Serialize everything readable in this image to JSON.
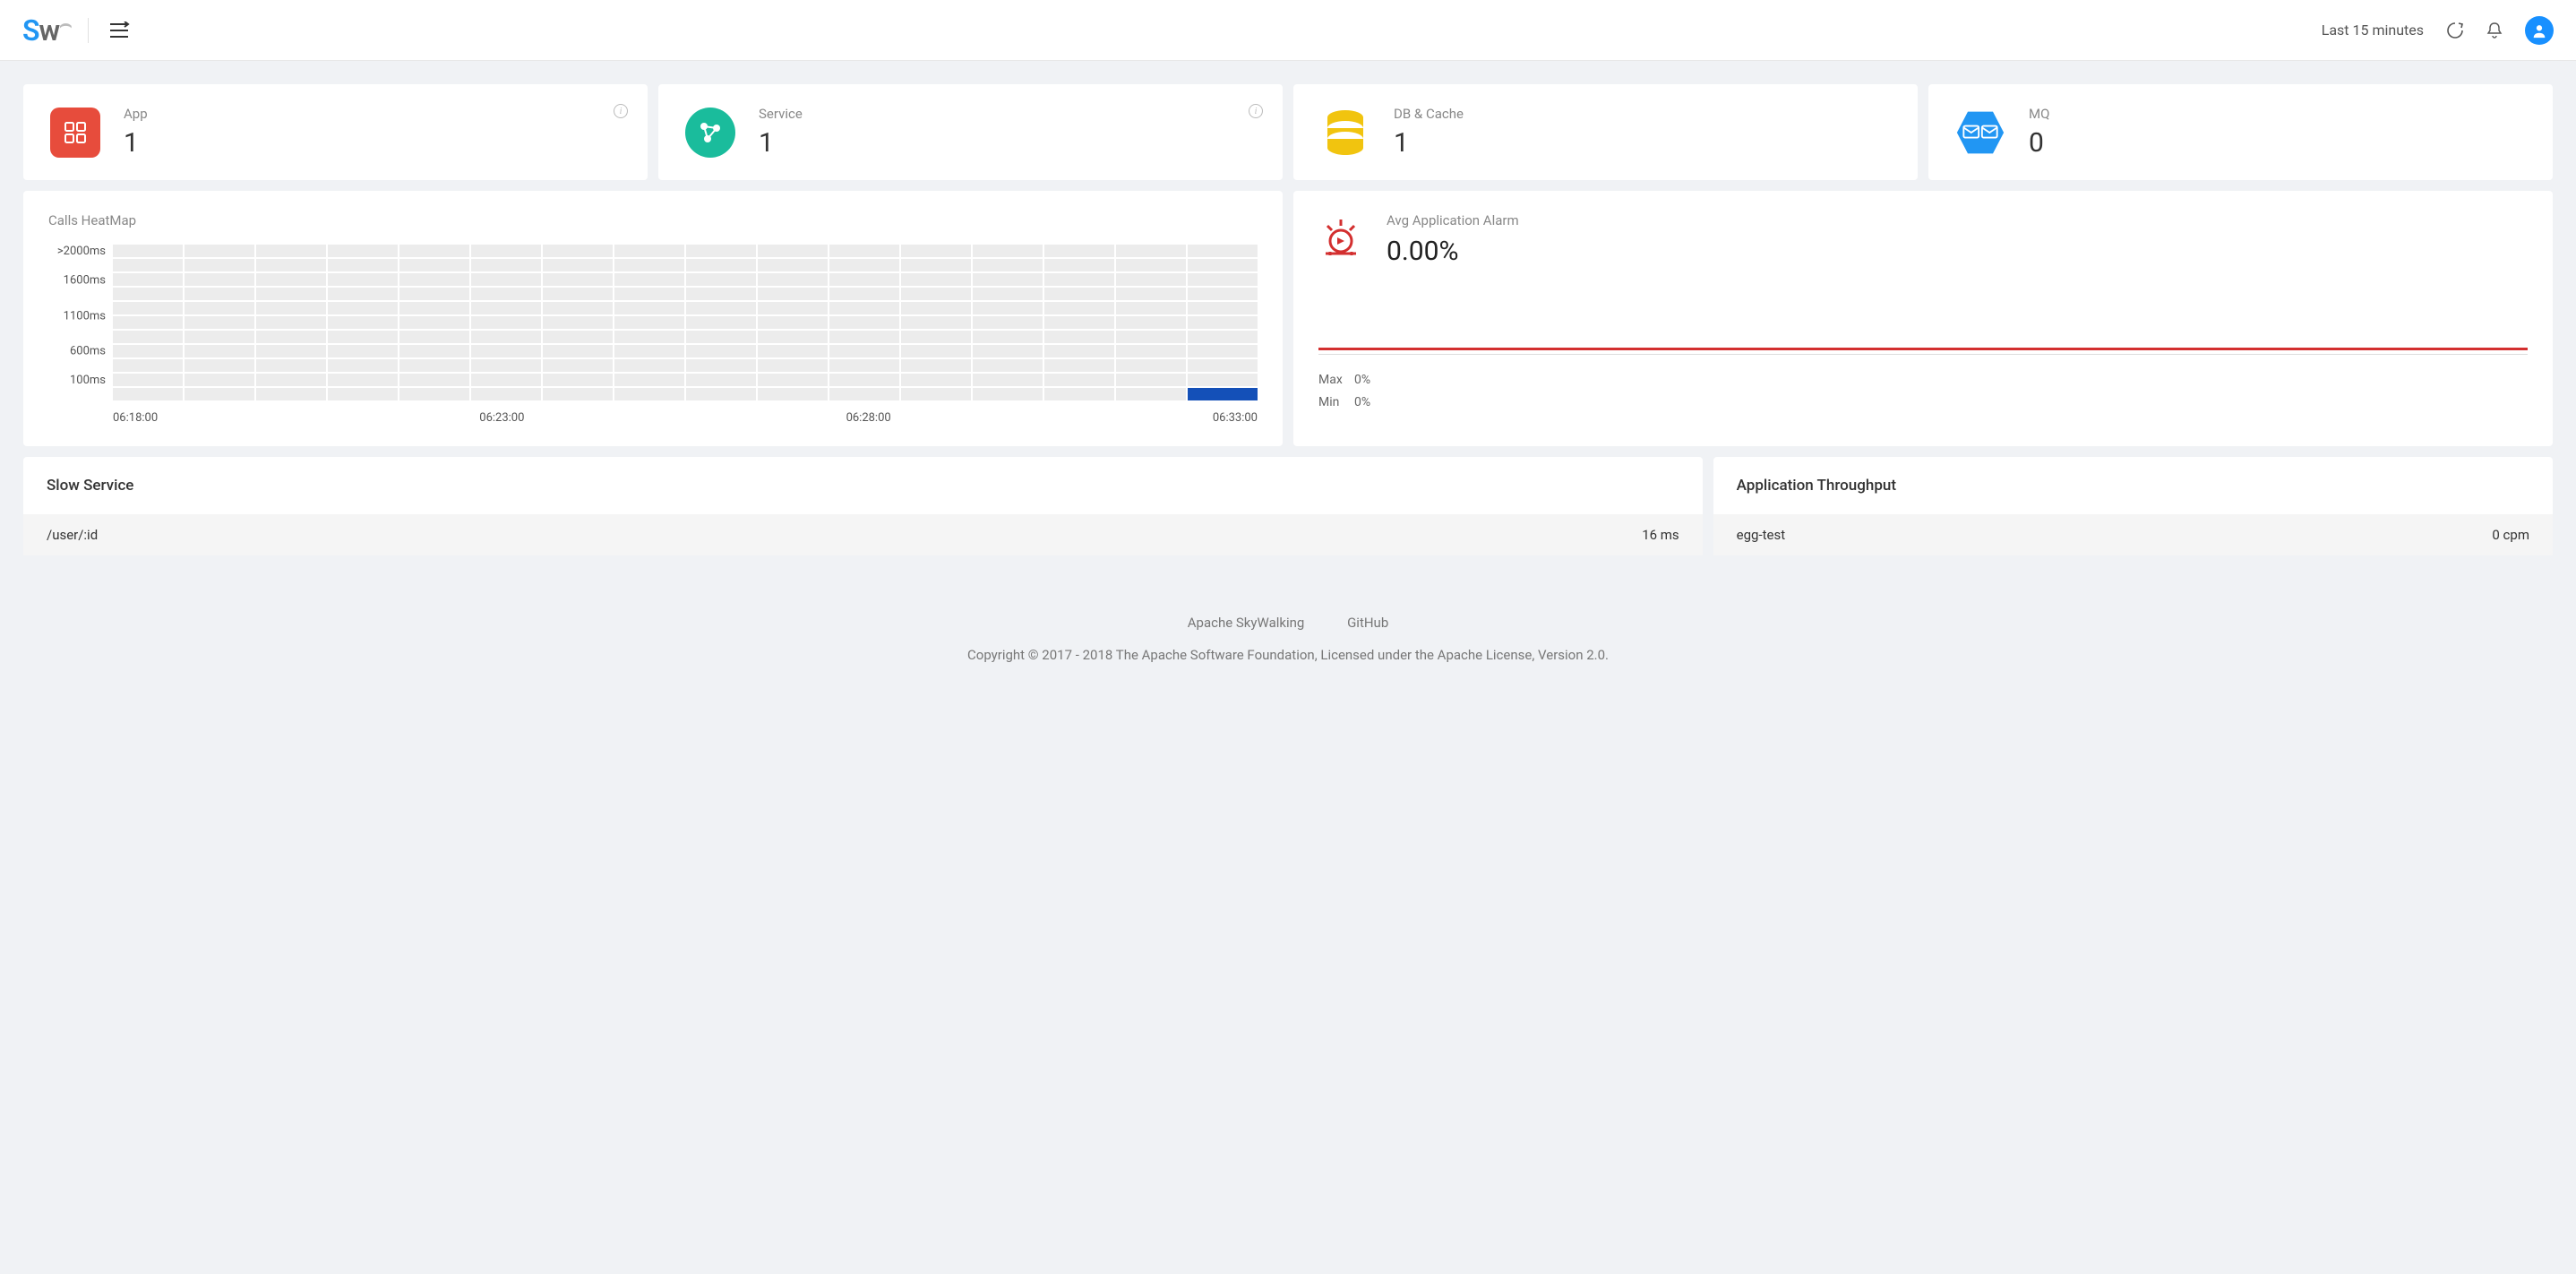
{
  "header": {
    "time_range": "Last 15 minutes"
  },
  "cards": [
    {
      "label": "App",
      "value": "1",
      "icon_bg": "#e74c3c",
      "info": true
    },
    {
      "label": "Service",
      "value": "1",
      "icon_bg": "#1abc9c",
      "info": true
    },
    {
      "label": "DB & Cache",
      "value": "1",
      "icon_bg": "#f1c40f",
      "info": false
    },
    {
      "label": "MQ",
      "value": "0",
      "icon_bg": "#2196f3",
      "info": false
    }
  ],
  "heatmap": {
    "title": "Calls HeatMap",
    "ylabels": [
      ">2000ms",
      "1600ms",
      "1100ms",
      "600ms",
      "100ms"
    ],
    "xlabels": [
      "06:18:00",
      "06:23:00",
      "06:28:00",
      "06:33:00"
    ]
  },
  "alarm": {
    "title": "Avg Application Alarm",
    "value": "0.00%",
    "max_label": "Max",
    "max_value": "0%",
    "min_label": "Min",
    "min_value": "0%"
  },
  "slow_service": {
    "title": "Slow Service",
    "rows": [
      {
        "name": "/user/:id",
        "value": "16 ms"
      }
    ]
  },
  "throughput": {
    "title": "Application Throughput",
    "rows": [
      {
        "name": "egg-test",
        "value": "0 cpm"
      }
    ]
  },
  "footer": {
    "link1": "Apache SkyWalking",
    "link2": "GitHub",
    "copyright": "Copyright © 2017 - 2018 The Apache Software Foundation, Licensed under the Apache License, Version 2.0."
  },
  "chart_data": {
    "type": "heatmap",
    "title": "Calls HeatMap",
    "x_range": [
      "06:18:00",
      "06:33:00"
    ],
    "x_step_minutes": 1,
    "y_bins": [
      "100ms",
      "600ms",
      "1100ms",
      "1600ms",
      ">2000ms"
    ],
    "cols": 16,
    "rows": 11,
    "hot_cells": [
      {
        "col": 15,
        "row_from_bottom": 0
      }
    ],
    "note": "All cells empty (0) except last time column at the lowest latency bin (~100ms)."
  }
}
